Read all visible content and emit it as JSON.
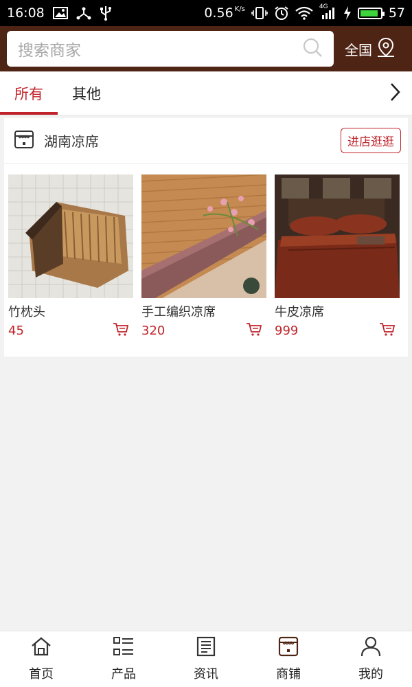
{
  "status_bar": {
    "time": "16:08",
    "net_speed": "0.56",
    "net_unit": "K/s",
    "network_type": "4G",
    "battery": "57",
    "battery_level": 0.9,
    "icons": [
      "image-icon",
      "share-icon",
      "usb-icon",
      "vibrate-icon",
      "alarm-icon",
      "wifi-icon",
      "signal-icon",
      "charging-icon",
      "battery-icon"
    ]
  },
  "header": {
    "search_placeholder": "搜索商家",
    "region_label": "全国"
  },
  "tabs": [
    {
      "label": "所有",
      "active": true
    },
    {
      "label": "其他",
      "active": false
    }
  ],
  "store": {
    "name": "湖南凉席",
    "visit_label": "进店逛逛",
    "products": [
      {
        "name": "竹枕头",
        "price": "45"
      },
      {
        "name": "手工编织凉席",
        "price": "320"
      },
      {
        "name": "牛皮凉席",
        "price": "999"
      }
    ]
  },
  "bottom_nav": [
    {
      "label": "首页",
      "icon": "home-icon"
    },
    {
      "label": "产品",
      "icon": "list-icon"
    },
    {
      "label": "资讯",
      "icon": "news-icon"
    },
    {
      "label": "商铺",
      "icon": "store-icon"
    },
    {
      "label": "我的",
      "icon": "user-icon"
    }
  ],
  "colors": {
    "header_bg": "#4e2414",
    "accent": "#c0232b",
    "page_bg": "#f2f2f2"
  }
}
